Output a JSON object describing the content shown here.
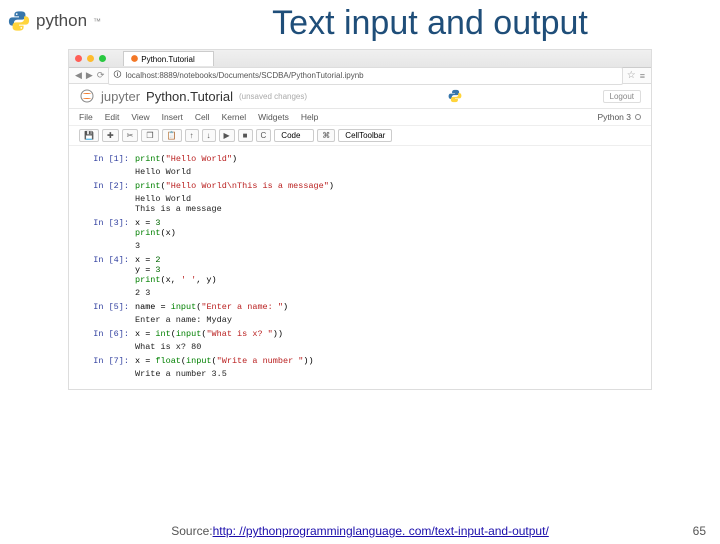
{
  "logo_text": "python",
  "slide_title": "Text input and output",
  "browser": {
    "tab_title": "Python.Tutorial",
    "address": "localhost:8889/notebooks/Documents/SCDBA/PythonTutorial.ipynb"
  },
  "jupyter": {
    "brand": "jupyter",
    "notebook_name": "Python.Tutorial",
    "save_status": "(unsaved changes)",
    "logout": "Logout",
    "kernel": "Python 3",
    "menu": {
      "file": "File",
      "edit": "Edit",
      "view": "View",
      "insert": "Insert",
      "cell": "Cell",
      "kernel": "Kernel",
      "widgets": "Widgets",
      "help": "Help"
    },
    "toolbar": {
      "save": "💾",
      "add": "✚",
      "cut": "✂",
      "copy": "❐",
      "paste": "📋",
      "up": "↑",
      "down": "↓",
      "run": "▶",
      "stop": "■",
      "restart": "C",
      "celltype": "Code",
      "keyboard": "⌘",
      "celltoolbar": "CellToolbar"
    }
  },
  "cells": [
    {
      "n": 1,
      "code_html": "<span class='fn'>print</span>(<span class='str'>\"Hello World\"</span>)",
      "output": "Hello World"
    },
    {
      "n": 2,
      "code_html": "<span class='fn'>print</span>(<span class='str'>\"Hello World\\nThis is a message\"</span>)",
      "output": "Hello World\nThis is a message"
    },
    {
      "n": 3,
      "code_html": "x = <span class='num'>3</span>\n<span class='fn'>print</span>(x)",
      "output": "3"
    },
    {
      "n": 4,
      "code_html": "x = <span class='num'>2</span>\ny = <span class='num'>3</span>\n<span class='fn'>print</span>(x, <span class='str'>' '</span>, y)",
      "output": "2   3"
    },
    {
      "n": 5,
      "code_html": "name = <span class='fn'>input</span>(<span class='str'>\"Enter a name: \"</span>)",
      "output": "Enter a name: Myday"
    },
    {
      "n": 6,
      "code_html": "x = <span class='fn'>int</span>(<span class='fn'>input</span>(<span class='str'>\"What is x? \"</span>))",
      "output": "What is x? 80"
    },
    {
      "n": 7,
      "code_html": "x = <span class='fn'>float</span>(<span class='fn'>input</span>(<span class='str'>\"Write a number \"</span>))",
      "output": "Write a number 3.5"
    }
  ],
  "footer": {
    "label": "Source: ",
    "url_text": "http: //pythonprogramminglanguage. com/text-input-and-output/"
  },
  "page_number": "65"
}
